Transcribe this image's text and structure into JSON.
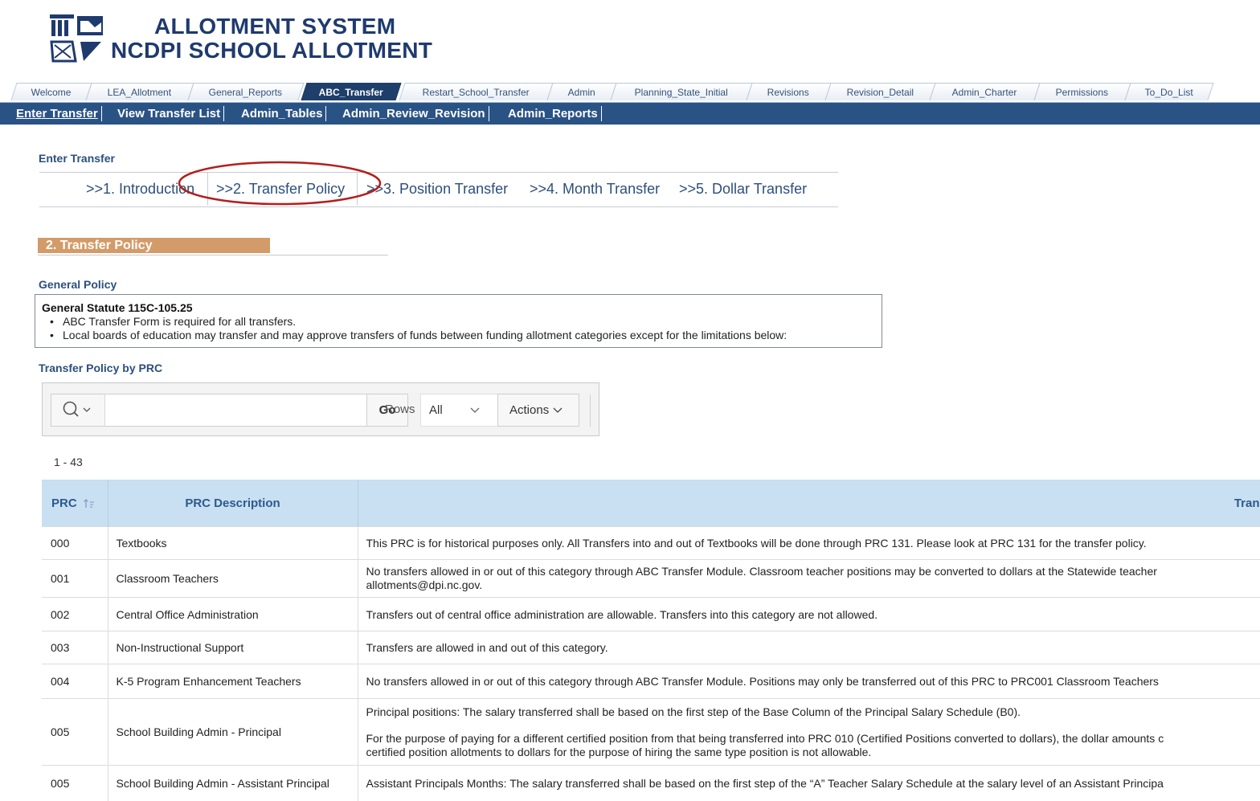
{
  "app": {
    "title_line1": "ALLOTMENT SYSTEM",
    "title_line2": "NCDPI SCHOOL ALLOTMENT"
  },
  "tabs": [
    "Welcome",
    "LEA_Allotment",
    "General_Reports",
    "ABC_Transfer",
    "Restart_School_Transfer",
    "Admin",
    "Planning_State_Initial",
    "Revisions",
    "Revision_Detail",
    "Admin_Charter",
    "Permissions",
    "To_Do_List"
  ],
  "active_tab": "ABC_Transfer",
  "subnav": [
    "Enter Transfer",
    "View Transfer List",
    "Admin_Tables",
    "Admin_Review_Revision",
    "Admin_Reports"
  ],
  "wizard": {
    "heading": "Enter Transfer",
    "steps": [
      ">>1. Introduction",
      ">>2. Transfer Policy",
      ">>3. Position Transfer",
      ">>4. Month Transfer",
      ">>5. Dollar Transfer"
    ],
    "active_step": 1
  },
  "section": {
    "title": "2. Transfer Policy"
  },
  "general_policy": {
    "heading": "General Policy",
    "statute": "General Statute 115C-105.25",
    "bullets": [
      "ABC Transfer Form is required for all transfers.",
      "Local boards of education may transfer and may approve transfers of funds between funding allotment categories except for the limitations below:"
    ]
  },
  "prc_policy": {
    "heading": "Transfer Policy by PRC"
  },
  "toolbar": {
    "search_icon": "search-icon",
    "search_value": "",
    "go_label": "Go",
    "rows_label": "Rows",
    "rows_value": "All",
    "actions_label": "Actions"
  },
  "pagination": "1 - 43",
  "table": {
    "headers": {
      "prc": "PRC",
      "description": "PRC Description",
      "policy": "Tran"
    },
    "rows": [
      {
        "prc": "000",
        "description": "Textbooks",
        "policy": "This PRC is for historical purposes only. All Transfers into and out of Textbooks will be done through PRC 131. Please look at PRC 131 for the transfer policy."
      },
      {
        "prc": "001",
        "description": "Classroom Teachers",
        "policy": "No transfers allowed in or out of this category through ABC Transfer Module. Classroom teacher positions may be converted to dollars at the Statewide teacher",
        "policy_2": "allotments@dpi.nc.gov."
      },
      {
        "prc": "002",
        "description": "Central Office Administration",
        "policy": "Transfers out of central office administration are allowable. Transfers into this category are not allowed."
      },
      {
        "prc": "003",
        "description": "Non-Instructional Support",
        "policy": "Transfers are allowed in and out of this category."
      },
      {
        "prc": "004",
        "description": "K-5 Program Enhancement Teachers",
        "policy": "No transfers allowed in or out of this category through ABC Transfer Module. Positions may only be transferred out of this PRC to PRC001 Classroom Teachers"
      },
      {
        "prc": "005",
        "description": "School Building Admin - Principal",
        "policy": "Principal positions: The salary transferred shall be based on the first step of the Base Column of the Principal Salary Schedule (B0).",
        "policy_2": "For the purpose of paying for a different certified position from that being transferred into PRC 010 (Certified Positions converted to dollars), the dollar amounts c",
        "policy_3": "certified position allotments to dollars for the purpose of hiring the same type position is not allowable."
      },
      {
        "prc": "005",
        "description": "School Building Admin - Assistant Principal",
        "policy": "Assistant Principals Months: The salary transferred shall be based on the first step of the “A” Teacher Salary Schedule at the salary level of an Assistant Principa"
      }
    ]
  }
}
